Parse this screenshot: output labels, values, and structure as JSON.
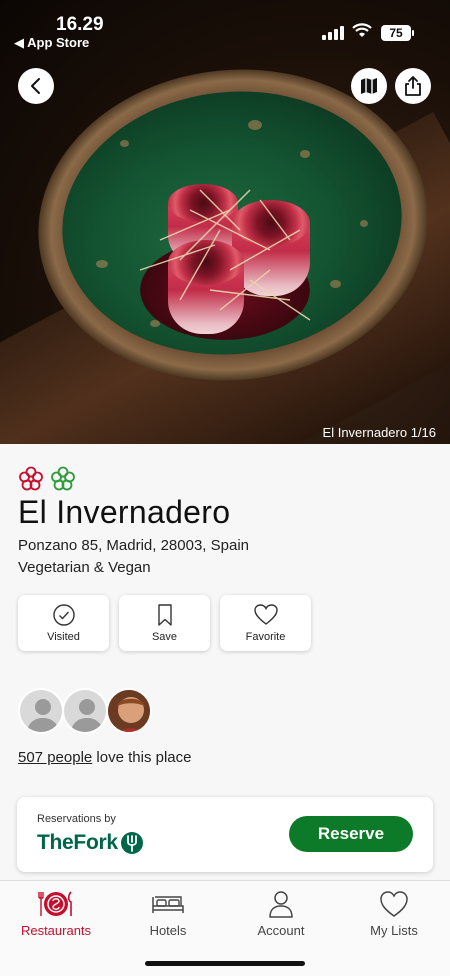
{
  "status_bar": {
    "time": "16.29",
    "back_app": "◀ App Store",
    "battery": "75"
  },
  "hero": {
    "caption": "El Invernadero 1/16"
  },
  "restaurant": {
    "name": "El Invernadero",
    "address": "Ponzano 85, Madrid, 28003, Spain",
    "cuisine": "Vegetarian & Vegan"
  },
  "actions": [
    {
      "label": "Visited",
      "icon": "check-circle-icon"
    },
    {
      "label": "Save",
      "icon": "bookmark-icon"
    },
    {
      "label": "Favorite",
      "icon": "heart-icon"
    }
  ],
  "social": {
    "count_link": "507 people",
    "suffix": " love this place"
  },
  "reservation": {
    "by_label": "Reservations by",
    "provider": "TheFork",
    "button": "Reserve"
  },
  "tabs": [
    {
      "label": "Restaurants",
      "icon": "restaurant-plate-icon",
      "active": true
    },
    {
      "label": "Hotels",
      "icon": "bed-icon",
      "active": false
    },
    {
      "label": "Account",
      "icon": "person-icon",
      "active": false
    },
    {
      "label": "My Lists",
      "icon": "heart-icon",
      "active": false
    }
  ],
  "colors": {
    "accent_red": "#c4102e",
    "reserve_green": "#0d7a2a",
    "fork_green": "#00664a",
    "star_red": "#c4102e",
    "star_green": "#2e9a3a"
  }
}
